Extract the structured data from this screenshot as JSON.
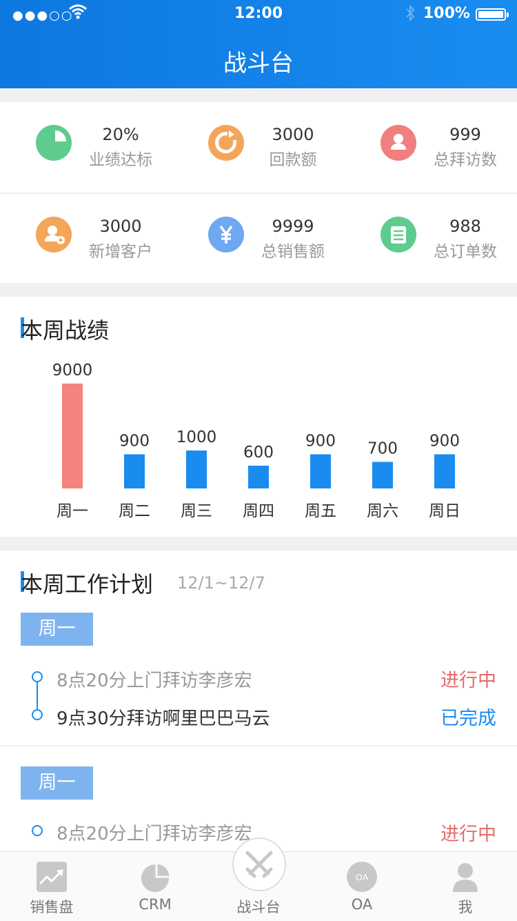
{
  "status_bar": {
    "signal": "●●●○○",
    "time": "12:00",
    "battery": "100%"
  },
  "header": {
    "title": "战斗台"
  },
  "stats": [
    {
      "value": "20%",
      "label": "业绩达标",
      "color": "#5ecb8f",
      "icon": "pie-chart-icon"
    },
    {
      "value": "3000",
      "label": "回款额",
      "color": "#f4a55a",
      "icon": "refresh-icon"
    },
    {
      "value": "999",
      "label": "总拜访数",
      "color": "#f07f7f",
      "icon": "person-icon"
    },
    {
      "value": "3000",
      "label": "新增客户",
      "color": "#f4a55a",
      "icon": "add-person-icon"
    },
    {
      "value": "9999",
      "label": "总销售额",
      "color": "#6ea8f0",
      "icon": "yen-icon"
    },
    {
      "value": "988",
      "label": "总订单数",
      "color": "#5ecb8f",
      "icon": "document-icon"
    }
  ],
  "week_section": {
    "title": "本周战绩"
  },
  "chart_data": {
    "type": "bar",
    "categories": [
      "周一",
      "周二",
      "周三",
      "周四",
      "周五",
      "周六",
      "周日"
    ],
    "values": [
      9000,
      900,
      1000,
      600,
      900,
      700,
      900
    ],
    "data_labels": [
      "9000",
      "900",
      "1000",
      "600",
      "900",
      "700",
      "900"
    ],
    "highlight_color": "#f5827c",
    "bar_color": "#1a8cf0"
  },
  "plan_section": {
    "title": "本周工作计划",
    "range": "12/1~12/7",
    "groups": [
      {
        "day": "周一",
        "tasks": [
          {
            "text": "8点20分上门拜访李彦宏",
            "status": "进行中"
          },
          {
            "text": "9点30分拜访啊里巴巴马云",
            "status": "已完成"
          }
        ]
      },
      {
        "day": "周一",
        "tasks": [
          {
            "text": "8点20分上门拜访李彦宏",
            "status": "进行中"
          }
        ]
      }
    ]
  },
  "tabbar": [
    {
      "label": "销售盘",
      "icon": "sales-chart-icon"
    },
    {
      "label": "CRM",
      "icon": "crm-pie-icon"
    },
    {
      "label": "战斗台",
      "icon": "crossed-swords-icon"
    },
    {
      "label": "OA",
      "icon": "oa-icon"
    },
    {
      "label": "我",
      "icon": "profile-icon"
    }
  ]
}
